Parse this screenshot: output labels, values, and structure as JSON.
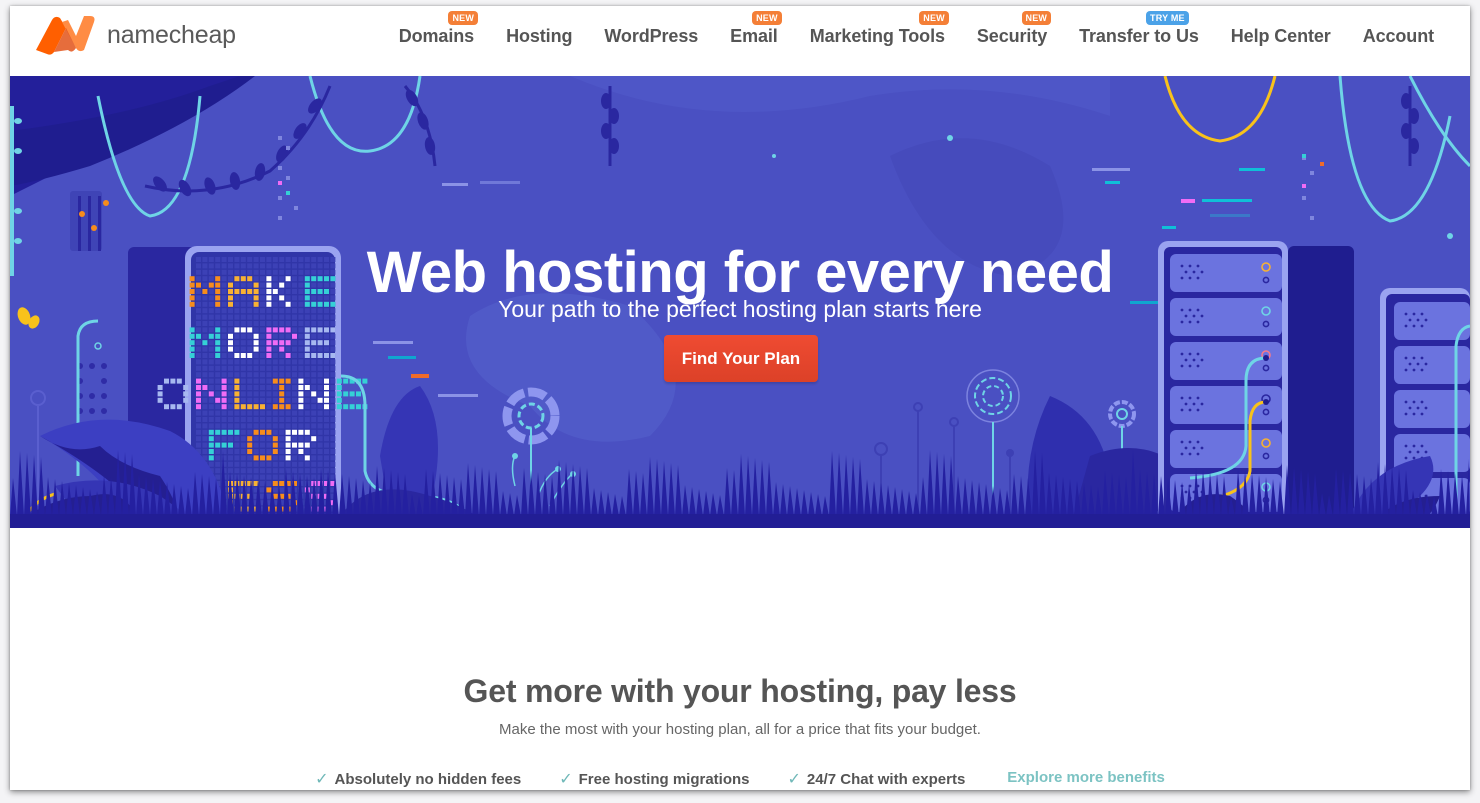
{
  "brand": {
    "name": "namecheap",
    "logo_colors": {
      "primary": "#ff5f00",
      "secondary": "#ff8c44"
    }
  },
  "nav": {
    "items": [
      {
        "label": "Domains",
        "badge": "NEW",
        "badge_type": "new"
      },
      {
        "label": "Hosting",
        "badge": null
      },
      {
        "label": "WordPress",
        "badge": null
      },
      {
        "label": "Email",
        "badge": "NEW",
        "badge_type": "new"
      },
      {
        "label": "Marketing Tools",
        "badge": "NEW",
        "badge_type": "new"
      },
      {
        "label": "Security",
        "badge": "NEW",
        "badge_type": "new"
      },
      {
        "label": "Transfer to Us",
        "badge": "TRY ME",
        "badge_type": "try"
      },
      {
        "label": "Help Center",
        "badge": null
      },
      {
        "label": "Account",
        "badge": null
      }
    ]
  },
  "hero": {
    "title": "Web hosting for every need",
    "subtitle": "Your path to the perfect hosting plan starts here",
    "cta_label": "Find Your Plan",
    "billboard_lines": [
      "MAKE",
      "MORE",
      "ONLINE",
      "FOR",
      "LESS"
    ],
    "colors": {
      "background": "#4a50c2",
      "dark": "#1f1d8f",
      "cta": "#e5462d",
      "cyan": "#6fd4e6",
      "yellow": "#f8c21b"
    }
  },
  "benefits_section": {
    "title": "Get more with your hosting, pay less",
    "subtitle": "Make the most with your hosting plan, all for a price that fits your budget.",
    "items": [
      {
        "icon": "check-icon",
        "label": "Absolutely no hidden fees"
      },
      {
        "icon": "check-icon",
        "label": "Free hosting migrations"
      },
      {
        "icon": "check-icon",
        "label": "24/7 Chat with experts"
      }
    ],
    "explore_link": "Explore more benefits"
  }
}
